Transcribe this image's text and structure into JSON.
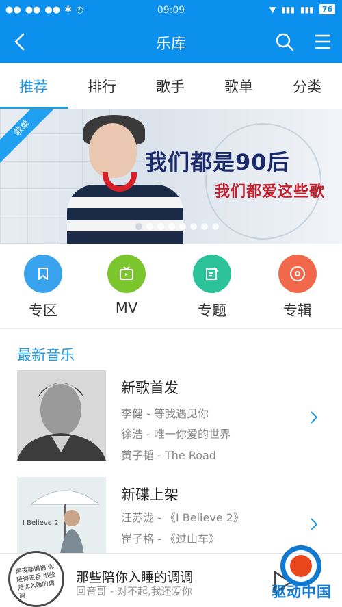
{
  "status_bar": {
    "time": "09:09",
    "battery": "76",
    "left_icons": [
      "wechat-icon",
      "wechat-icon",
      "wechat-icon",
      "bluetooth-icon",
      "alarm-icon"
    ],
    "right_icons": [
      "wifi-icon",
      "signal-icon",
      "signal-icon",
      "battery-icon"
    ]
  },
  "app_bar": {
    "title": "乐库",
    "back_icon": "back-arrow-icon",
    "search_icon": "search-icon",
    "menu_icon": "menu-icon"
  },
  "tabs": [
    {
      "label": "推荐",
      "active": true
    },
    {
      "label": "排行",
      "active": false
    },
    {
      "label": "歌手",
      "active": false
    },
    {
      "label": "歌单",
      "active": false
    },
    {
      "label": "分类",
      "active": false
    }
  ],
  "banner": {
    "ribbon": "歌单",
    "headline1": "我们都是90后",
    "headline2": "我们都爱这些歌",
    "dot_count": 8,
    "active_dot": 0
  },
  "quick_entries": [
    {
      "label": "专区",
      "icon": "bookmark-icon",
      "color": "#3aa3ee"
    },
    {
      "label": "MV",
      "icon": "tv-icon",
      "color": "#7bc62d"
    },
    {
      "label": "专题",
      "icon": "edit-note-icon",
      "color": "#2cc39a"
    },
    {
      "label": "专辑",
      "icon": "disc-icon",
      "color": "#f2684a"
    }
  ],
  "latest_music": {
    "title": "最新音乐",
    "cards": [
      {
        "title": "新歌首发",
        "lines": [
          {
            "artist": "李健",
            "sep": " - ",
            "song": "等我遇见你"
          },
          {
            "artist": "徐浩",
            "sep": " - ",
            "song": "唯一你爱的世界"
          },
          {
            "artist": "黄子韬",
            "sep": " - ",
            "song": "The Road"
          }
        ]
      },
      {
        "title": "新碟上架",
        "lines": [
          {
            "artist": "汪苏泷",
            "sep": " - ",
            "song": "《I Believe 2》"
          },
          {
            "artist": "崔子格",
            "sep": " - ",
            "song": "《过山车》"
          }
        ],
        "cover_text": "I Believe 2"
      }
    ]
  },
  "player": {
    "title": "那些陪你入睡的调调",
    "subtitle": "回音哥 - 对不起,我还爱你",
    "disc_text": "黑夜静悄悄 你睡得正香 那些陪你入睡的调调"
  },
  "watermark": {
    "text": "驱动中国"
  },
  "colors": {
    "primary": "#0c90ee",
    "tab_active": "#1f9ae8",
    "text_main": "#333333",
    "text_sub": "#888888"
  }
}
